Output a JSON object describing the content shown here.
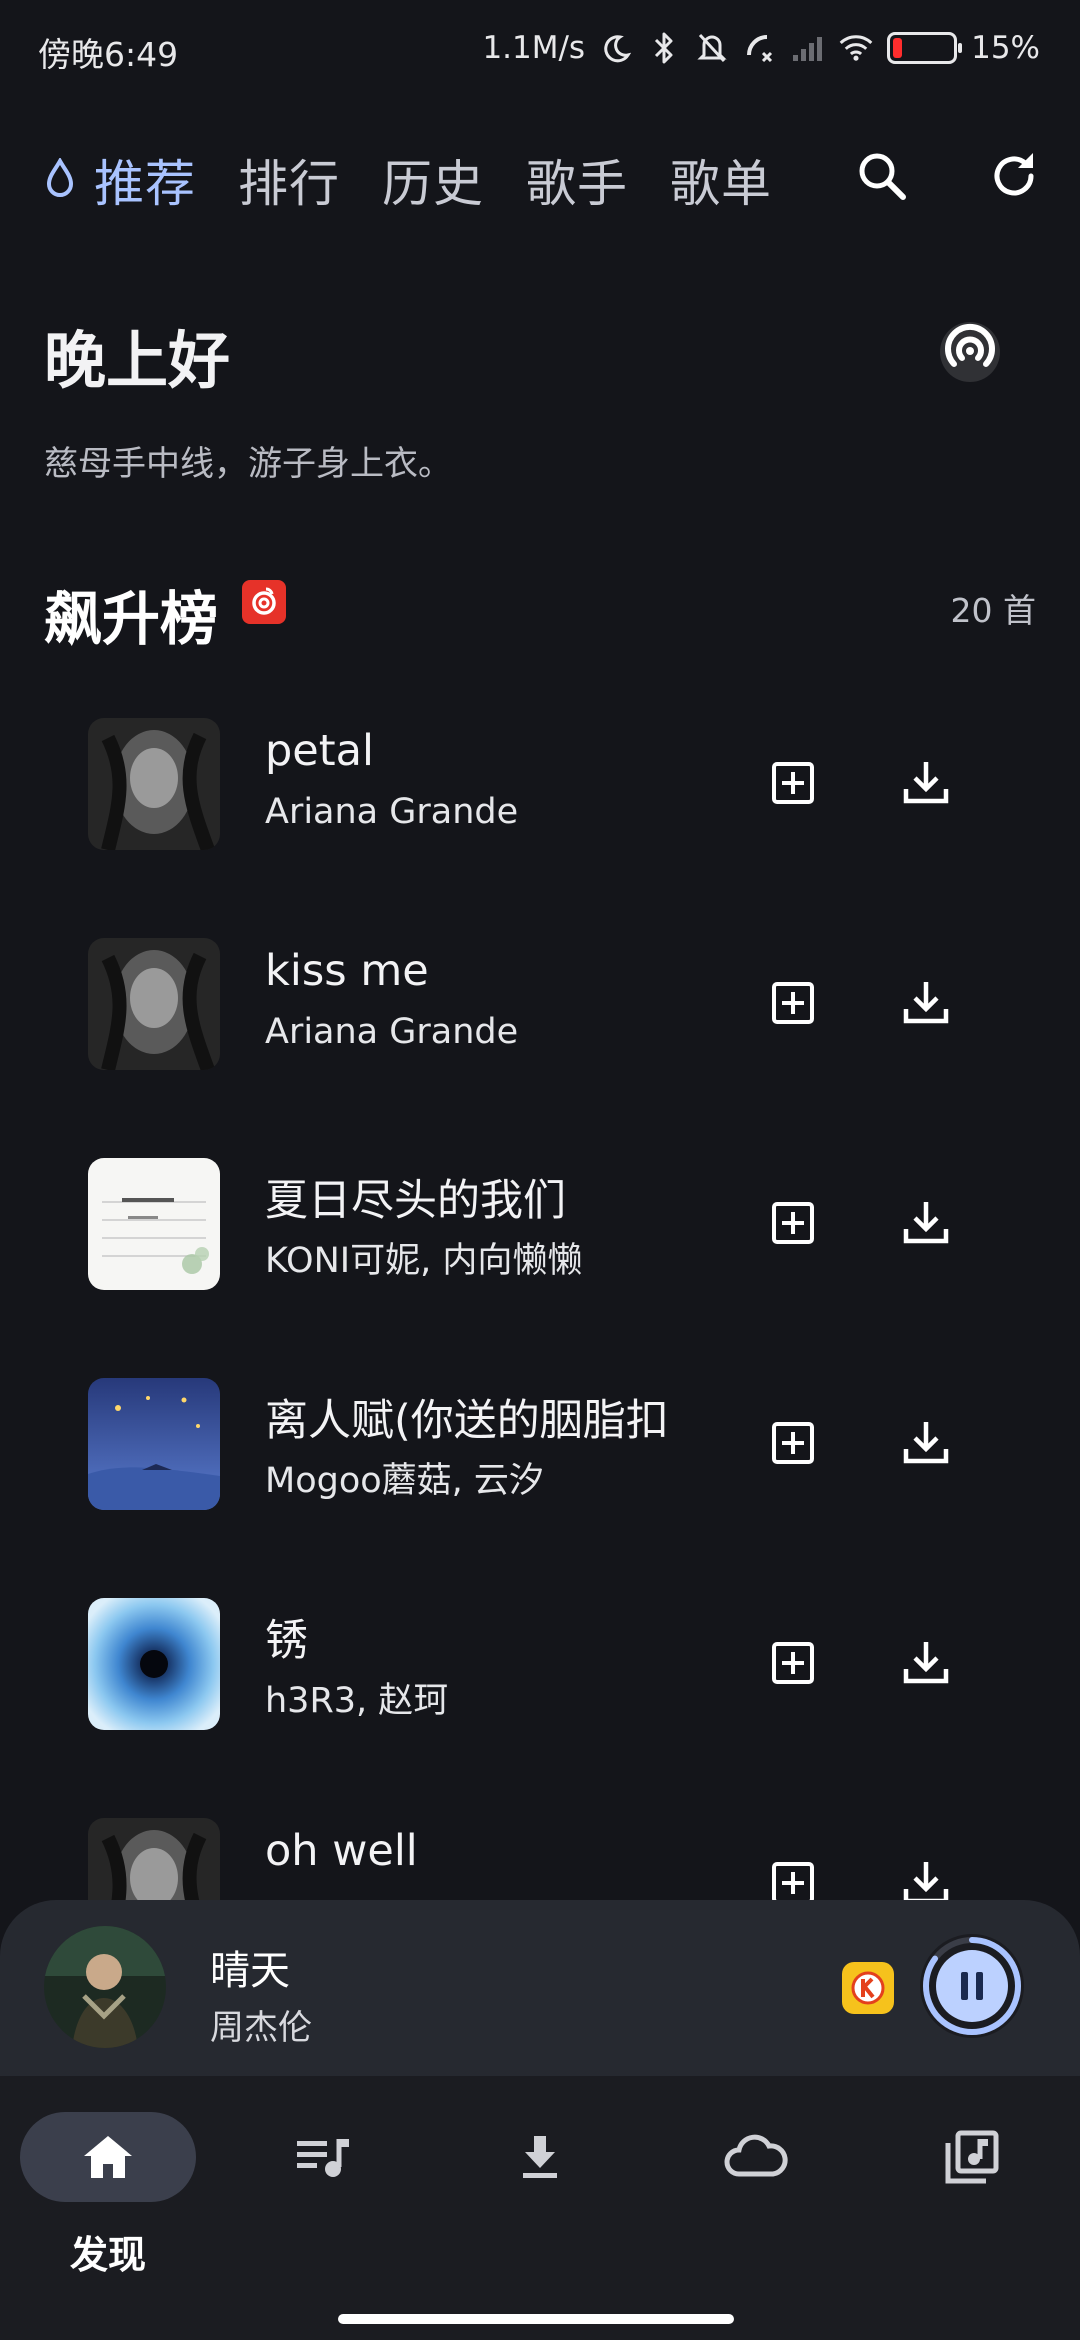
{
  "status_bar": {
    "time": "傍晚6:49",
    "net_speed": "1.1M/s",
    "battery": "15%",
    "battery_level": 0.15
  },
  "top_nav": {
    "tabs": [
      {
        "label": "推荐",
        "active": true
      },
      {
        "label": "排行",
        "active": false
      },
      {
        "label": "历史",
        "active": false
      },
      {
        "label": "歌手",
        "active": false
      },
      {
        "label": "歌单",
        "active": false
      }
    ],
    "search_icon": "search-icon",
    "refresh_icon": "refresh-icon"
  },
  "greeting": {
    "title": "晚上好",
    "subtitle": "慈母手中线，游子身上衣。",
    "radio_icon": "radio-icon"
  },
  "chart": {
    "title": "飙升榜",
    "count": "20 首",
    "songs": [
      {
        "title": "petal",
        "artist": "Ariana Grande",
        "cover": "bw-portrait"
      },
      {
        "title": "kiss me",
        "artist": "Ariana Grande",
        "cover": "bw-portrait"
      },
      {
        "title": "夏日尽头的我们",
        "artist": "KONI可妮, 内向懒懒",
        "cover": "paper-note"
      },
      {
        "title": "离人赋(你送的胭脂扣",
        "artist": "Mogoo蘑菇, 云汐",
        "cover": "blue-night"
      },
      {
        "title": "锈",
        "artist": "h3R3, 赵珂",
        "cover": "blue-eye"
      },
      {
        "title": "oh well",
        "artist": "",
        "cover": "bw-portrait"
      }
    ]
  },
  "mini_player": {
    "title": "晴天",
    "artist": "周杰伦",
    "progress": 0.85
  },
  "bottom_nav": {
    "items": [
      {
        "label": "发现",
        "icon": "home-icon",
        "active": true
      },
      {
        "label": "",
        "icon": "playlist-icon",
        "active": false
      },
      {
        "label": "",
        "icon": "download-icon",
        "active": false
      },
      {
        "label": "",
        "icon": "cloud-icon",
        "active": false
      },
      {
        "label": "",
        "icon": "music-library-icon",
        "active": false
      }
    ]
  },
  "colors": {
    "background": "#14151a",
    "accent": "#a9c3ff",
    "netease_red": "#e63229",
    "player_bg": "#262930"
  }
}
